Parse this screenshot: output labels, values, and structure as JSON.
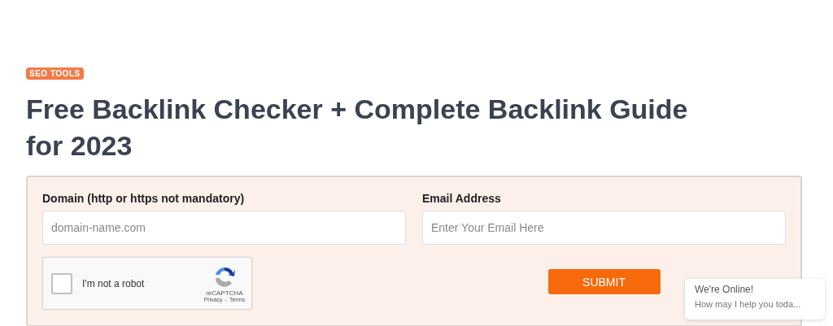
{
  "tag": "SEO TOOLS",
  "title": "Free Backlink Checker + Complete Backlink Guide for 2023",
  "form": {
    "fields": [
      {
        "label": "Domain (http or https not mandatory)",
        "placeholder": "domain-name.com"
      },
      {
        "label": "Email Address",
        "placeholder": "Enter Your Email Here"
      }
    ],
    "captcha": {
      "label": "I'm not a robot",
      "checked": false,
      "brand": "reCAPTCHA",
      "privacy": "Privacy",
      "separator": "-",
      "terms": "Terms"
    },
    "submit": "SUBMIT"
  },
  "chat": {
    "title": "We're Online!",
    "message": "How may I help you toda..."
  }
}
